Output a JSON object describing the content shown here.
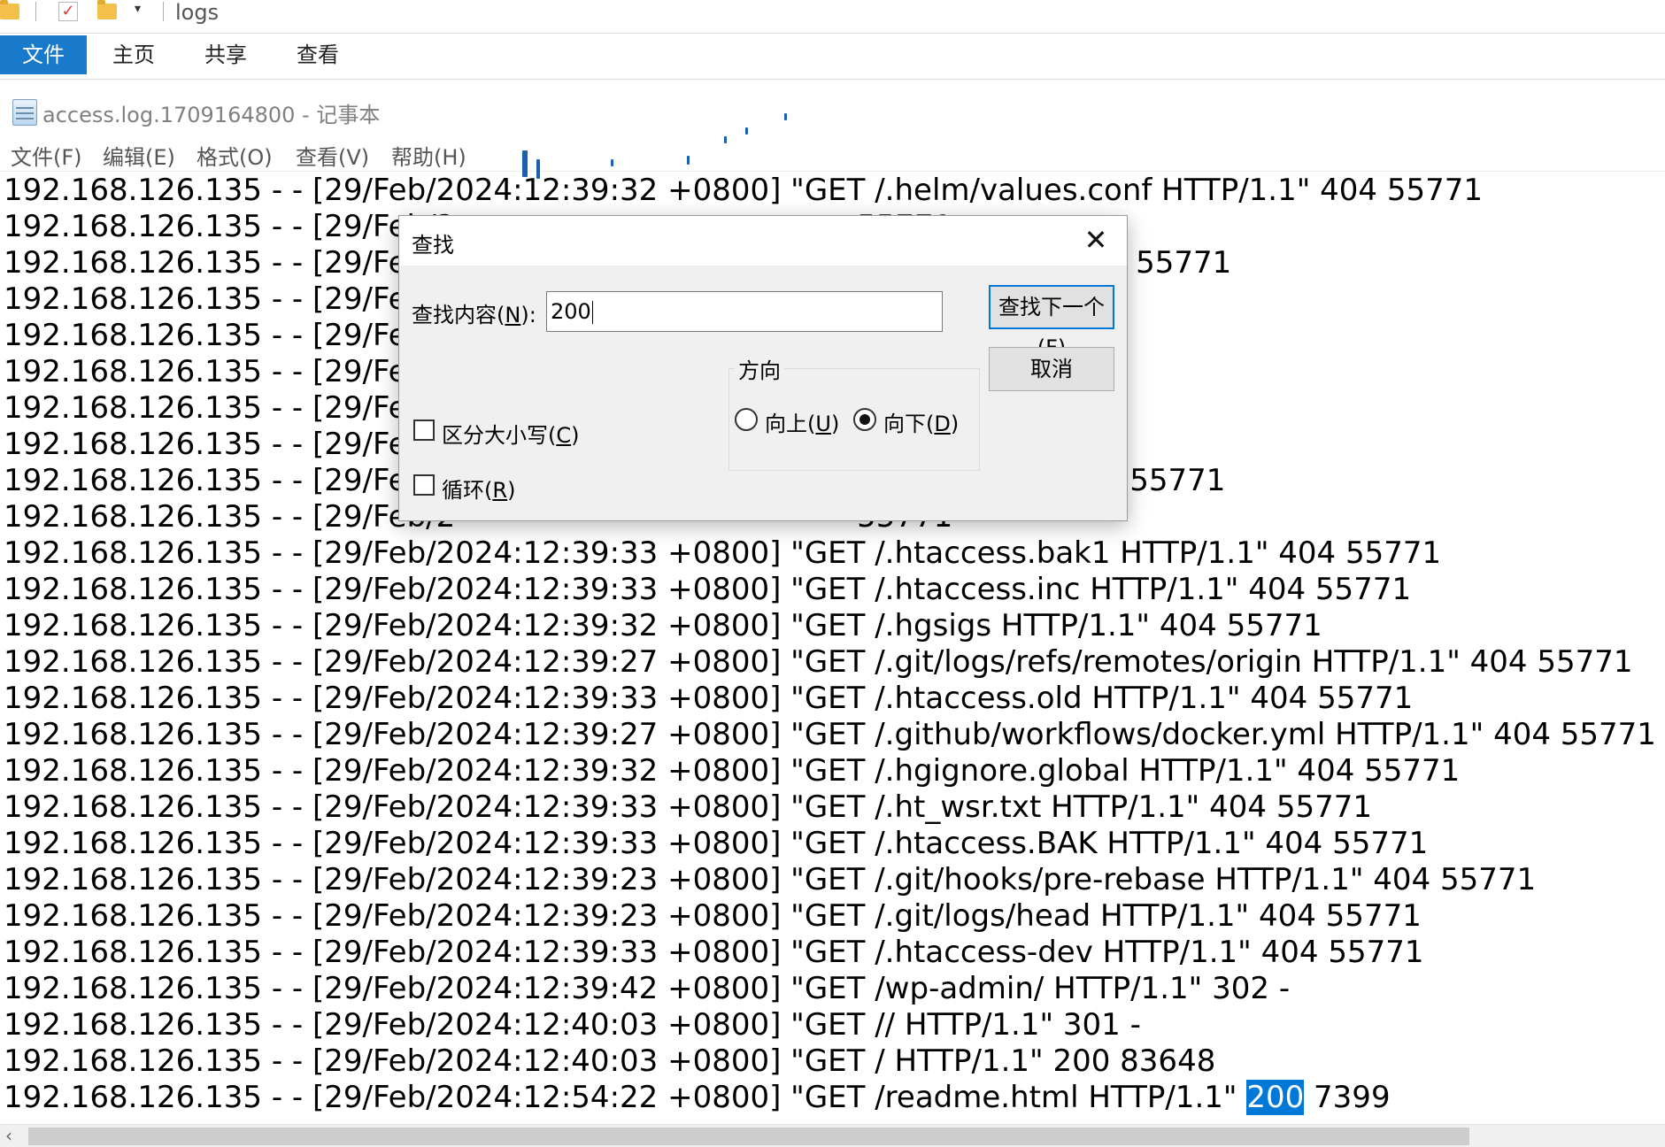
{
  "explorer": {
    "title": "logs",
    "tabs": [
      "文件",
      "主页",
      "共享",
      "查看"
    ]
  },
  "notepad": {
    "title": "access.log.1709164800 - 记事本",
    "menu": [
      "文件(F)",
      "编辑(E)",
      "格式(O)",
      "查看(V)",
      "帮助(H)"
    ]
  },
  "log_lines": [
    "192.168.126.135 - - [29/Feb/2024:12:39:32 +0800] \"GET /.helm/values.conf HTTP/1.1\" 404 55771",
    "192.168.126.135 - - [29/Feb/2                                          55771",
    "192.168.126.135 - - [29/Feb/2                                          AD HTTP/1.1\" 404 55771",
    "192.168.126.135 - - [29/Feb/2",
    "192.168.126.135 - - [29/Feb/2",
    "192.168.126.135 - - [29/Feb/2                                          71",
    "192.168.126.135 - - [29/Feb/2                                          04 55771",
    "192.168.126.135 - - [29/Feb/2                                          404 55771",
    "192.168.126.135 - - [29/Feb/2                                          ml HTTP/1.1\" 404 55771",
    "192.168.126.135 - - [29/Feb/2                                          55771",
    "192.168.126.135 - - [29/Feb/2024:12:39:33 +0800] \"GET /.htaccess.bak1 HTTP/1.1\" 404 55771",
    "192.168.126.135 - - [29/Feb/2024:12:39:33 +0800] \"GET /.htaccess.inc HTTP/1.1\" 404 55771",
    "192.168.126.135 - - [29/Feb/2024:12:39:32 +0800] \"GET /.hgsigs HTTP/1.1\" 404 55771",
    "192.168.126.135 - - [29/Feb/2024:12:39:27 +0800] \"GET /.git/logs/refs/remotes/origin HTTP/1.1\" 404 55771",
    "192.168.126.135 - - [29/Feb/2024:12:39:33 +0800] \"GET /.htaccess.old HTTP/1.1\" 404 55771",
    "192.168.126.135 - - [29/Feb/2024:12:39:27 +0800] \"GET /.github/workflows/docker.yml HTTP/1.1\" 404 55771",
    "192.168.126.135 - - [29/Feb/2024:12:39:32 +0800] \"GET /.hgignore.global HTTP/1.1\" 404 55771",
    "192.168.126.135 - - [29/Feb/2024:12:39:33 +0800] \"GET /.ht_wsr.txt HTTP/1.1\" 404 55771",
    "192.168.126.135 - - [29/Feb/2024:12:39:33 +0800] \"GET /.htaccess.BAK HTTP/1.1\" 404 55771",
    "192.168.126.135 - - [29/Feb/2024:12:39:23 +0800] \"GET /.git/hooks/pre-rebase HTTP/1.1\" 404 55771",
    "192.168.126.135 - - [29/Feb/2024:12:39:23 +0800] \"GET /.git/logs/head HTTP/1.1\" 404 55771",
    "192.168.126.135 - - [29/Feb/2024:12:39:33 +0800] \"GET /.htaccess-dev HTTP/1.1\" 404 55771",
    "192.168.126.135 - - [29/Feb/2024:12:39:42 +0800] \"GET /wp-admin/ HTTP/1.1\" 302 -",
    "192.168.126.135 - - [29/Feb/2024:12:40:03 +0800] \"GET // HTTP/1.1\" 301 -",
    "192.168.126.135 - - [29/Feb/2024:12:40:03 +0800] \"GET / HTTP/1.1\" 200 83648"
  ],
  "highlighted_line": {
    "before": "192.168.126.135 - - [29/Feb/2024:12:54:22 +0800] \"GET /readme.html HTTP/1.1\" ",
    "match": "200",
    "after": " 7399"
  },
  "find_dialog": {
    "title": "查找",
    "find_label_prefix": "查找内容(",
    "find_label_key": "N",
    "find_label_suffix": "):",
    "find_value": "200",
    "find_next_prefix": "查找下一个(",
    "find_next_key": "F",
    "find_next_suffix": ")",
    "cancel": "取消",
    "direction_label": "方向",
    "up_prefix": "向上(",
    "up_key": "U",
    "up_suffix": ")",
    "down_prefix": "向下(",
    "down_key": "D",
    "down_suffix": ")",
    "match_case_prefix": "区分大小写(",
    "match_case_key": "C",
    "match_case_suffix": ")",
    "wrap_prefix": "循环(",
    "wrap_key": "R",
    "wrap_suffix": ")",
    "match_case_checked": false,
    "wrap_checked": false,
    "direction": "down"
  },
  "colors": {
    "accent": "#0078d7",
    "ribbon_file_tab": "#1979ca"
  }
}
